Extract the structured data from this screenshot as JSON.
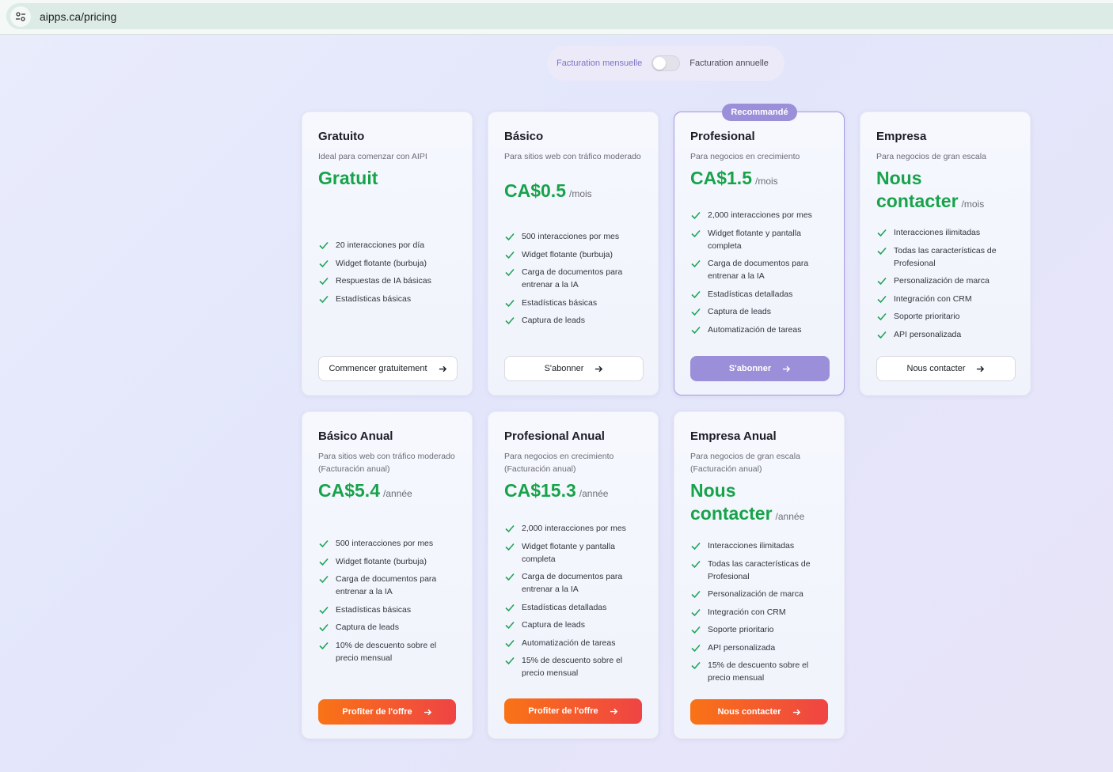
{
  "browser": {
    "url": "aipps.ca/pricing"
  },
  "billing_toggle": {
    "monthly_label": "Facturation mensuelle",
    "annual_label": "Facturation annuelle"
  },
  "colors": {
    "accent_purple": "#9c8fd9",
    "price_green": "#17a34a",
    "orange_start": "#f97316",
    "orange_end": "#ef4444"
  },
  "plans": [
    {
      "name": "Gratuito",
      "description": "Ideal para comenzar con AIPI",
      "price": "Gratuit",
      "period": "",
      "features": [
        "20 interacciones por día",
        "Widget flotante (burbuja)",
        "Respuestas de IA básicas",
        "Estadísticas básicas"
      ],
      "button": "Commencer gratuitement"
    },
    {
      "name": "Básico",
      "description": "Para sitios web con tráfico moderado",
      "price": "CA$0.5",
      "period": "/mois",
      "features": [
        "500 interacciones por mes",
        "Widget flotante (burbuja)",
        "Carga de documentos para entrenar a la IA",
        "Estadísticas básicas",
        "Captura de leads"
      ],
      "button": "S'abonner"
    },
    {
      "name": "Profesional",
      "badge": "Recommandé",
      "description": "Para negocios en crecimiento",
      "price": "CA$1.5",
      "period": "/mois",
      "features": [
        "2,000 interacciones por mes",
        "Widget flotante y pantalla completa",
        "Carga de documentos para entrenar a la IA",
        "Estadísticas detalladas",
        "Captura de leads",
        "Automatización de tareas"
      ],
      "button": "S'abonner"
    },
    {
      "name": "Empresa",
      "description": "Para negocios de gran escala",
      "price": "Nous contacter",
      "period": "/mois",
      "features": [
        "Interacciones ilimitadas",
        "Todas las características de Profesional",
        "Personalización de marca",
        "Integración con CRM",
        "Soporte prioritario",
        "API personalizada"
      ],
      "button": "Nous contacter"
    },
    {
      "name": "Básico Anual",
      "description": "Para sitios web con tráfico moderado (Facturación anual)",
      "price": "CA$5.4",
      "period": "/année",
      "features": [
        "500 interacciones por mes",
        "Widget flotante (burbuja)",
        "Carga de documentos para entrenar a la IA",
        "Estadísticas básicas",
        "Captura de leads",
        "10% de descuento sobre el precio mensual"
      ],
      "button": "Profiter de l'offre"
    },
    {
      "name": "Profesional Anual",
      "description": "Para negocios en crecimiento (Facturación anual)",
      "price": "CA$15.3",
      "period": "/année",
      "features": [
        "2,000 interacciones por mes",
        "Widget flotante y pantalla completa",
        "Carga de documentos para entrenar a la IA",
        "Estadísticas detalladas",
        "Captura de leads",
        "Automatización de tareas",
        "15% de descuento sobre el precio mensual"
      ],
      "button": "Profiter de l'offre"
    },
    {
      "name": "Empresa Anual",
      "description": "Para negocios de gran escala (Facturación anual)",
      "price": "Nous contacter",
      "period": "/année",
      "features": [
        "Interacciones ilimitadas",
        "Todas las características de Profesional",
        "Personalización de marca",
        "Integración con CRM",
        "Soporte prioritario",
        "API personalizada",
        "15% de descuento sobre el precio mensual"
      ],
      "button": "Nous contacter"
    }
  ]
}
